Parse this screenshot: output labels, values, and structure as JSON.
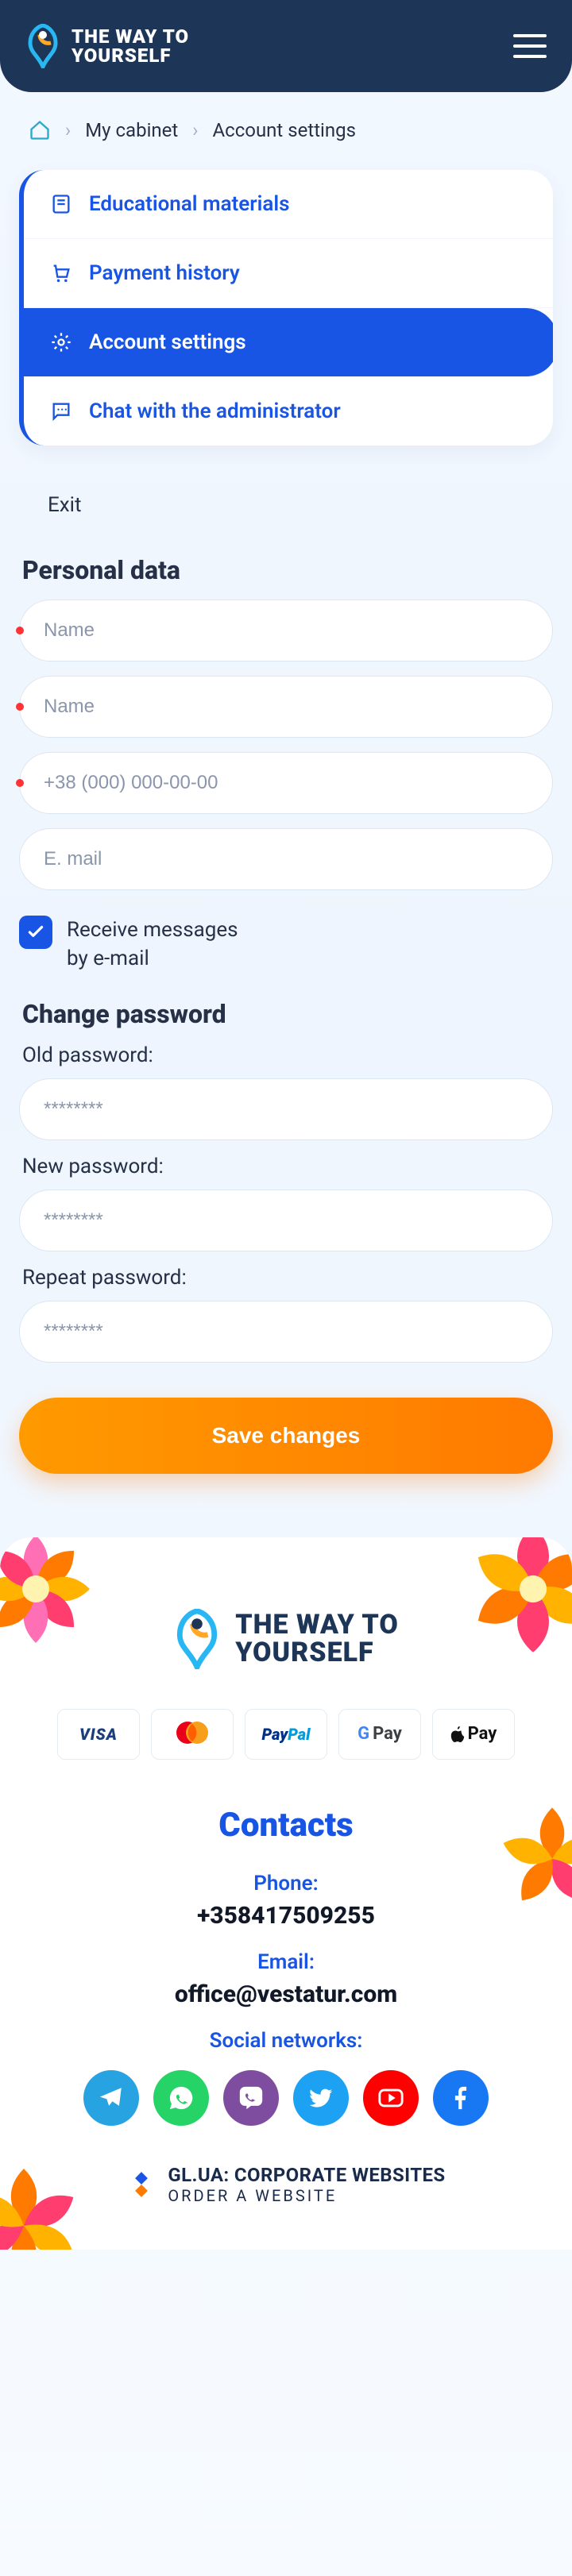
{
  "header": {
    "brand_line1": "THE WAY TO",
    "brand_line2": "YOURSELF"
  },
  "breadcrumb": {
    "cabinet": "My cabinet",
    "current": "Account settings"
  },
  "nav": {
    "items": [
      {
        "label": "Educational materials"
      },
      {
        "label": "Payment history"
      },
      {
        "label": "Account settings"
      },
      {
        "label": "Chat with the administrator"
      }
    ],
    "exit": "Exit"
  },
  "personal": {
    "title": "Personal data",
    "placeholders": {
      "first_name": "Name",
      "last_name": "Name",
      "phone": "+38 (000) 000-00-00",
      "email": "E. mail"
    },
    "checkbox_line1": "Receive messages",
    "checkbox_line2": "by e-mail"
  },
  "password": {
    "title": "Change password",
    "old_label": "Old password:",
    "new_label": "New password:",
    "repeat_label": "Repeat password:",
    "mask": "********"
  },
  "actions": {
    "save": "Save changes"
  },
  "footer": {
    "contacts_title": "Contacts",
    "phone_label": "Phone:",
    "phone_value": "+358417509255",
    "email_label": "Email:",
    "email_value": "office@vestatur.com",
    "social_label": "Social networks:",
    "glua_line1": "GL.UA: CORPORATE WEBSITES",
    "glua_line2": "ORDER A WEBSITE",
    "pay": {
      "visa": "VISA",
      "paypal_1": "Pay",
      "paypal_2": "Pal",
      "gpay_g": "G",
      "gpay_pay": "Pay",
      "apay": "Pay"
    }
  }
}
